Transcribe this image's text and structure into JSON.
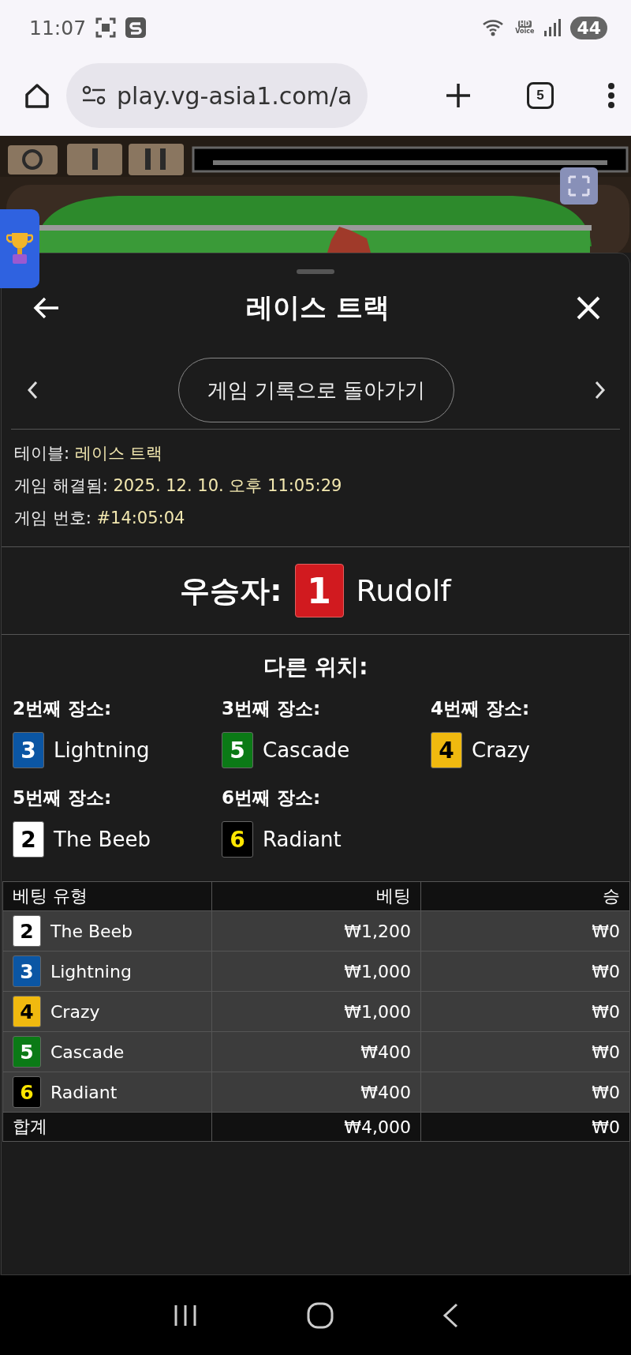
{
  "status_bar": {
    "time": "11:07",
    "voice_badge_top": "HD",
    "voice_badge_bottom": "Voice",
    "battery": "44"
  },
  "browser": {
    "url": "play.vg-asia1.com/a",
    "tab_count": "5"
  },
  "sheet": {
    "title": "레이스 트랙",
    "history_button": "게임 기록으로 돌아가기"
  },
  "info": [
    {
      "label": "테이블:",
      "value": "레이스 트랙"
    },
    {
      "label": "게임 해결됨:",
      "value": "2025. 12. 10. 오후 11:05:29"
    },
    {
      "label": "게임 번호:",
      "value": "#14:05:04"
    }
  ],
  "winner": {
    "label": "우승자:",
    "number": "1",
    "name": "Rudolf",
    "color": "#d11a1f"
  },
  "other_places": {
    "title": "다른 위치:",
    "places": [
      {
        "label": "2번째 장소:",
        "number": "3",
        "name": "Lightning",
        "color": "#0b56a4"
      },
      {
        "label": "3번째 장소:",
        "number": "5",
        "name": "Cascade",
        "color": "#0b7a16"
      },
      {
        "label": "4번째 장소:",
        "number": "4",
        "name": "Crazy",
        "color": "#f0b90f"
      },
      {
        "label": "5번째 장소:",
        "number": "2",
        "name": "The Beeb",
        "color": "#ffffff"
      },
      {
        "label": "6번째 장소:",
        "number": "6",
        "name": "Radiant",
        "color": "#000000"
      }
    ]
  },
  "bets_table": {
    "columns": [
      "베팅 유형",
      "베팅",
      "승"
    ],
    "rows": [
      {
        "number": "2",
        "name": "The Beeb",
        "color": "#ffffff",
        "bet": "₩1,200",
        "win": "₩0"
      },
      {
        "number": "3",
        "name": "Lightning",
        "color": "#0b56a4",
        "bet": "₩1,000",
        "win": "₩0"
      },
      {
        "number": "4",
        "name": "Crazy",
        "color": "#f0b90f",
        "bet": "₩1,000",
        "win": "₩0"
      },
      {
        "number": "5",
        "name": "Cascade",
        "color": "#0b7a16",
        "bet": "₩400",
        "win": "₩0"
      },
      {
        "number": "6",
        "name": "Radiant",
        "color": "#000000",
        "bet": "₩400",
        "win": "₩0"
      }
    ],
    "total": {
      "label": "합계",
      "bet": "₩4,000",
      "win": "₩0"
    }
  }
}
